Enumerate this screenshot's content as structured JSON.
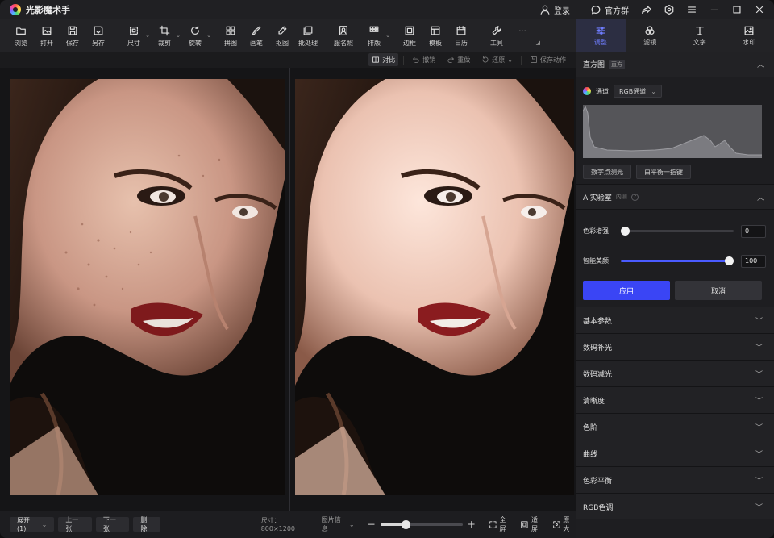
{
  "titlebar": {
    "app_title": "光影魔术手",
    "login": "登录",
    "official_group": "官方群"
  },
  "toolbar": {
    "tools": [
      {
        "label": "浏览",
        "icon": "folder-icon"
      },
      {
        "label": "打开",
        "icon": "image-open-icon"
      },
      {
        "label": "保存",
        "icon": "save-icon"
      },
      {
        "label": "另存",
        "icon": "save-as-icon"
      },
      {
        "label": "尺寸",
        "icon": "resize-icon"
      },
      {
        "label": "裁剪",
        "icon": "crop-icon"
      },
      {
        "label": "旋转",
        "icon": "rotate-icon"
      },
      {
        "label": "拼图",
        "icon": "collage-icon"
      },
      {
        "label": "画笔",
        "icon": "brush-icon"
      },
      {
        "label": "抠图",
        "icon": "cutout-icon"
      },
      {
        "label": "批处理",
        "icon": "batch-icon"
      },
      {
        "label": "服名照",
        "icon": "id-photo-icon"
      },
      {
        "label": "排版",
        "icon": "layout-icon"
      },
      {
        "label": "边框",
        "icon": "border-icon"
      },
      {
        "label": "模板",
        "icon": "template-icon"
      },
      {
        "label": "日历",
        "icon": "calendar-icon"
      },
      {
        "label": "工具",
        "icon": "wrench-icon"
      },
      {
        "label": "···",
        "icon": "more-icon"
      }
    ]
  },
  "panel_tabs": [
    {
      "label": "调整",
      "active": true
    },
    {
      "label": "滤镜",
      "active": false
    },
    {
      "label": "文字",
      "active": false
    },
    {
      "label": "水印",
      "active": false
    }
  ],
  "subbar": {
    "compare": "对比",
    "undo": "撤销",
    "redo": "重做",
    "restore": "还原",
    "save_action": "保存动作"
  },
  "bottombar": {
    "expand": "展开(1)",
    "prev": "上一张",
    "next": "下一张",
    "delete": "删除",
    "size": "尺寸：800×1200",
    "image_info": "图片信息",
    "fullscreen": "全屏",
    "fit": "适屏",
    "original": "原大",
    "zoom_level": 0.3
  },
  "histogram": {
    "title": "直方图",
    "badge": "直方",
    "channel_label": "通道",
    "channel_value": "RGB通道",
    "digital_spot": "数字点测光",
    "white_balance": "白平衡一指键"
  },
  "ai_lab": {
    "title": "AI实验室",
    "subtitle": "内测",
    "color_enhance_label": "色彩增强",
    "color_enhance_value": "0",
    "color_enhance_level": 0,
    "beauty_label": "智能美颜",
    "beauty_value": "100",
    "beauty_level": 1.0,
    "apply": "应用",
    "cancel": "取消"
  },
  "sections": [
    "基本参数",
    "数码补光",
    "数码减光",
    "清晰度",
    "色阶",
    "曲线",
    "色彩平衡",
    "RGB色调"
  ],
  "colors": {
    "accent": "#3a45f5",
    "active_tab": "#6f7dff",
    "lips": "#8a1c1f"
  }
}
